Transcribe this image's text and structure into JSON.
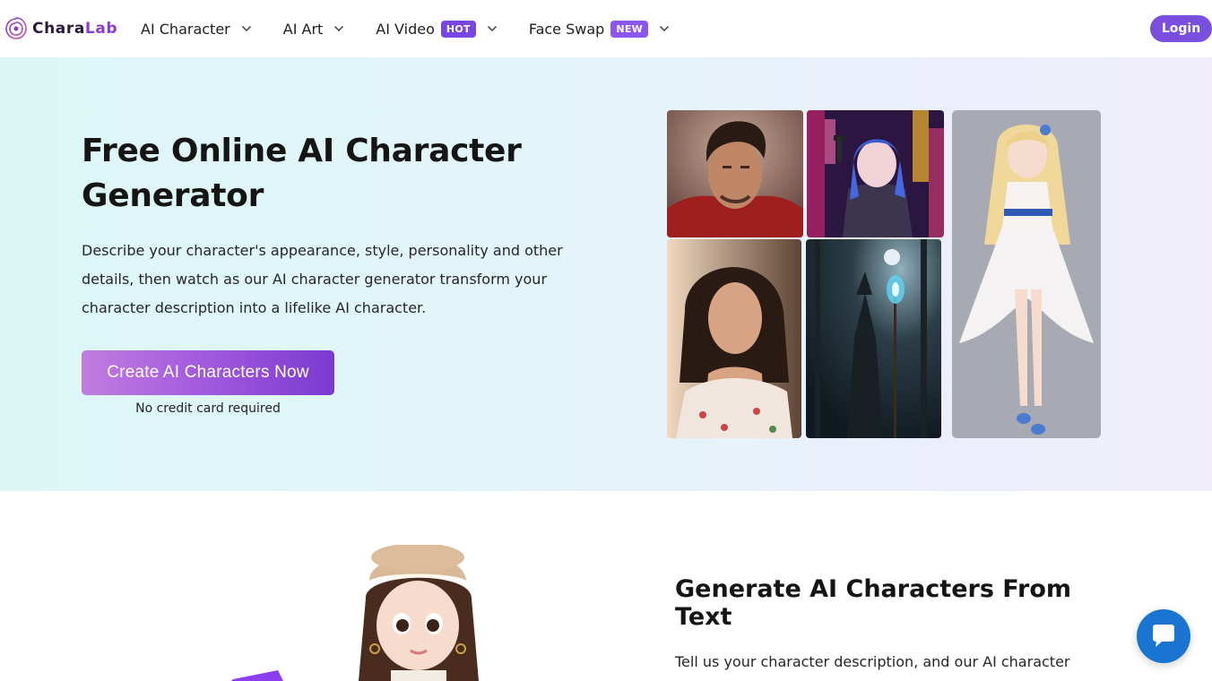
{
  "header": {
    "logo": {
      "text_part1": "Chara",
      "text_part2": "Lab",
      "icon": "spiral-logo-icon"
    },
    "nav": [
      {
        "label": "AI Character",
        "badge": null,
        "icon": "chevron-down-icon"
      },
      {
        "label": "AI Art",
        "badge": null,
        "icon": "chevron-down-icon"
      },
      {
        "label": "AI Video",
        "badge": "HOT",
        "icon": "chevron-down-icon"
      },
      {
        "label": "Face Swap",
        "badge": "NEW",
        "icon": "chevron-down-icon"
      }
    ],
    "login_label": "Login"
  },
  "hero": {
    "title": "Free Online AI Character Generator",
    "description": "Describe your character's appearance, style, personality and other details, then watch as our AI character generator transform your character description into a lifelike AI character.",
    "cta_label": "Create AI Characters Now",
    "cta_note": "No credit card required",
    "gallery": [
      "portrait-man-red-hoodie-image",
      "anime-girl-neon-gun-image",
      "portrait-woman-floral-dress-image",
      "hooded-wizard-dark-forest-image",
      "anime-girl-white-dress-image"
    ]
  },
  "section2": {
    "title": "Generate AI Characters From Text",
    "text": "Tell us your character description, and our AI character",
    "illustration": "3d-cartoon-girl-beret-image"
  },
  "chat_widget": {
    "icon": "chat-bubble-icon"
  },
  "colors": {
    "brand_purple": "#7a4fe0",
    "cta_gradient_start": "#c27be0",
    "cta_gradient_end": "#7a3bd0",
    "chat_blue": "#1a75d2",
    "hero_bg_start": "#dcf6f6",
    "hero_bg_end": "#f1edfb"
  }
}
